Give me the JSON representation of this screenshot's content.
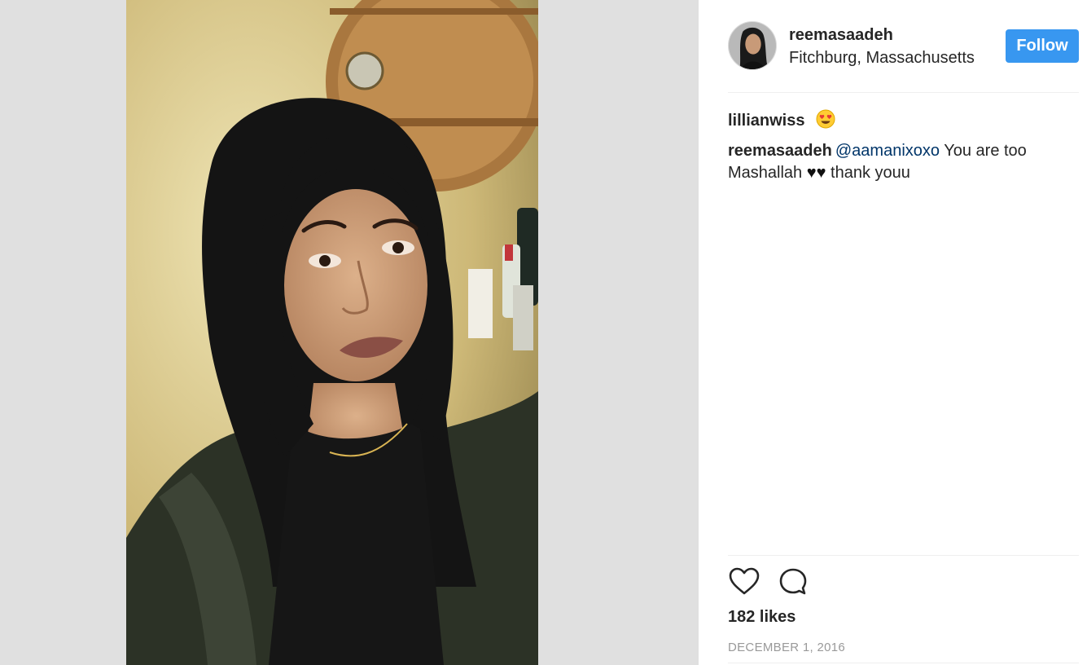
{
  "post": {
    "username": "reemasaadeh",
    "location": "Fitchburg, Massachusetts",
    "follow_label": "Follow",
    "avatar_icon": "profile-avatar",
    "photo_icon": "selfie-photo"
  },
  "comments": [
    {
      "user": "lillianwiss",
      "text": "",
      "emoji": "heart-eyes-emoji"
    },
    {
      "user": "reemasaadeh",
      "mention": "@aamanixoxo",
      "text": " You are too Mashallah ",
      "hearts": "♥♥",
      "text_after": " thank youu"
    }
  ],
  "actions": {
    "like_icon": "heart-icon",
    "comment_icon": "comment-icon"
  },
  "likes_label": "182 likes",
  "date_label": "DECEMBER 1, 2016",
  "colors": {
    "follow_button": "#3897f0",
    "mention": "#003569",
    "date": "#999999",
    "media_background": "#e0e0e0"
  }
}
